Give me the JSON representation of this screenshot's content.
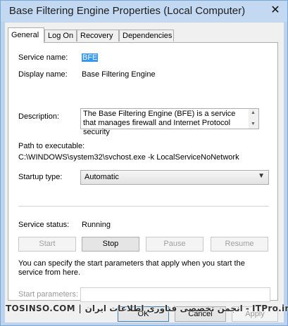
{
  "window": {
    "title": "Base Filtering Engine Properties (Local Computer)",
    "close_glyph": "✕"
  },
  "tabs": [
    {
      "label": "General",
      "active": true
    },
    {
      "label": "Log On",
      "active": false
    },
    {
      "label": "Recovery",
      "active": false
    },
    {
      "label": "Dependencies",
      "active": false
    }
  ],
  "general": {
    "service_name_label": "Service name:",
    "service_name_value": "BFE",
    "display_name_label": "Display name:",
    "display_name_value": "Base Filtering Engine",
    "description_label": "Description:",
    "description_value": "The Base Filtering Engine (BFE) is a service that manages firewall and Internet Protocol security",
    "path_label": "Path to executable:",
    "path_value": "C:\\WINDOWS\\system32\\svchost.exe -k LocalServiceNoNetwork",
    "startup_type_label": "Startup type:",
    "startup_type_value": "Automatic",
    "status_label": "Service status:",
    "status_value": "Running",
    "buttons": {
      "start": "Start",
      "stop": "Stop",
      "pause": "Pause",
      "resume": "Resume"
    },
    "info_text": "You can specify the start parameters that apply when you start the service from here.",
    "start_params_label": "Start parameters:",
    "start_params_value": ""
  },
  "footer": {
    "ok": "OK",
    "cancel": "Cancel",
    "apply": "Apply"
  },
  "watermark": {
    "text": "TOSINSO.COM | انجمن تخصصی فناوری اطلاعات ایران - ITPro.ir"
  },
  "icons": {
    "scroll_up": "▲",
    "scroll_down": "▼",
    "dropdown": "▼"
  }
}
